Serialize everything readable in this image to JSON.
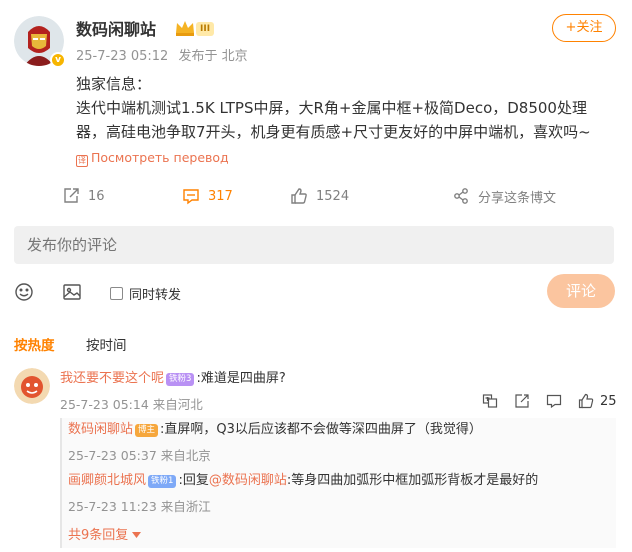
{
  "post": {
    "author": "数码闲聊站",
    "level_badge": "III",
    "verified_mark": "v",
    "timestamp": "25-7-23 05:12",
    "location": "发布于 北京",
    "follow_label": "+关注",
    "text_line1": "独家信息：",
    "text_line2": "迭代中端机测试1.5K LTPS中屏，大R角+金属中框+极简Deco，D8500处理器，高硅电池争取7开头，机身更有质感+尺寸更友好的中屏中端机，喜欢吗~",
    "translate_label": "Посмотреть перевод",
    "translate_icon_char": "译"
  },
  "actions": {
    "repost_count": "16",
    "comment_count": "317",
    "like_count": "1524",
    "share_label": "分享这条博文"
  },
  "composer": {
    "placeholder": "发布你的评论",
    "repost_label": "同时转发",
    "submit_label": "评论"
  },
  "sort": {
    "hot_label": "按热度",
    "time_label": "按时间"
  },
  "comments": [
    {
      "username": "我还要不要这个呢",
      "badge": "铁粉3",
      "text": ":难道是四曲屏?",
      "timestamp": "25-7-23 05:14",
      "location": "来自河北",
      "like_count": "25",
      "replies": [
        {
          "username": "数码闲聊站",
          "badge": "博主",
          "text": ":直屏啊，Q3以后应该都不会做等深四曲屏了（我觉得）",
          "timestamp": "25-7-23 05:37",
          "location": "来自北京"
        },
        {
          "username": "画卿颜北城风",
          "badge": "铁粉1",
          "text_prefix": ":回复",
          "mention": "@数码闲聊站",
          "text": ":等身四曲加弧形中框加弧形背板才是最好的",
          "timestamp": "25-7-23 11:23",
          "location": "来自浙江"
        }
      ],
      "more_replies": "共9条回复"
    }
  ],
  "colors": {
    "accent_orange": "#ff8200",
    "link_orange": "#eb7350",
    "submit_disabled": "#fbc59f",
    "muted": "#939393"
  }
}
